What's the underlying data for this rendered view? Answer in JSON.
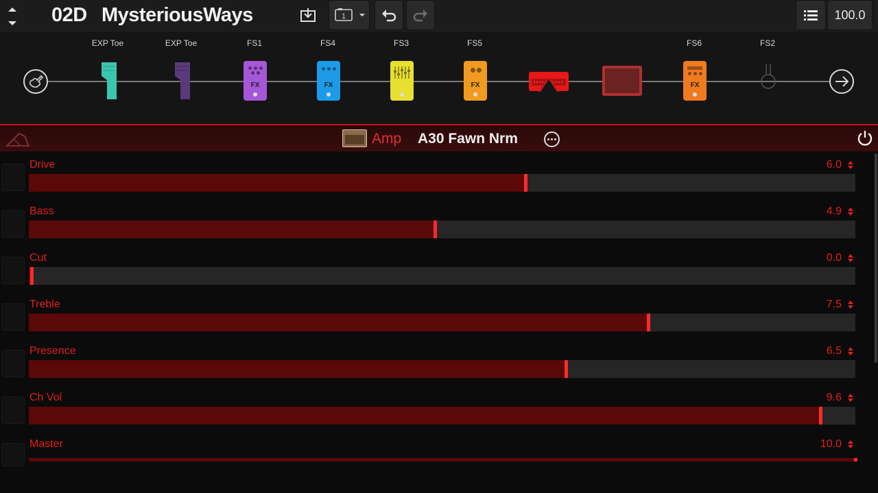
{
  "topbar": {
    "preset_number": "02D",
    "preset_name": "MysteriousWays",
    "tempo": "100.0"
  },
  "chain": {
    "labels": [
      "EXP Toe",
      "EXP Toe",
      "FS1",
      "FS4",
      "FS3",
      "FS5",
      "FS6",
      "FS2"
    ],
    "fx_text": "FX",
    "colors": {
      "teal": "#3cc6b0",
      "purple_dim": "#5a3a7a",
      "purple": "#a657d8",
      "blue": "#1e9be8",
      "yellow": "#e8e030",
      "orange": "#f09a20",
      "orange_red": "#f07a20",
      "amp_red": "#e81818"
    }
  },
  "model": {
    "category": "Amp",
    "name": "A30 Fawn Nrm"
  },
  "params": [
    {
      "label": "Drive",
      "value": "6.0",
      "fraction": 0.601
    },
    {
      "label": "Bass",
      "value": "4.9",
      "fraction": 0.491
    },
    {
      "label": "Cut",
      "value": "0.0",
      "fraction": 0.003
    },
    {
      "label": "Treble",
      "value": "7.5",
      "fraction": 0.749
    },
    {
      "label": "Presence",
      "value": "6.5",
      "fraction": 0.65
    },
    {
      "label": "Ch Vol",
      "value": "9.6",
      "fraction": 0.958
    },
    {
      "label": "Master",
      "value": "10.0",
      "fraction": 1.0
    }
  ]
}
